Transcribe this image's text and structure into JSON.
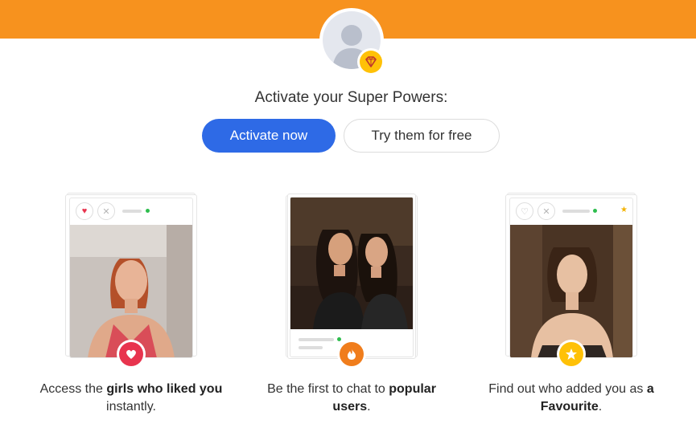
{
  "headline": "Activate your Super Powers:",
  "buttons": {
    "activate": "Activate now",
    "try_free": "Try them for free"
  },
  "features": [
    {
      "caption": [
        {
          "text": "Access the ",
          "bold": false
        },
        {
          "text": "girls who liked you",
          "bold": true
        },
        {
          "text": " instantly.",
          "bold": false
        }
      ],
      "badge_icon": "heart-icon",
      "badge_color": "#e8344e"
    },
    {
      "caption": [
        {
          "text": "Be the first to chat to ",
          "bold": false
        },
        {
          "text": "popular users",
          "bold": true
        },
        {
          "text": ".",
          "bold": false
        }
      ],
      "badge_icon": "flame-icon",
      "badge_color": "#f07d1c"
    },
    {
      "caption": [
        {
          "text": "Find out who added you as ",
          "bold": false
        },
        {
          "text": "a Favourite",
          "bold": true
        },
        {
          "text": ".",
          "bold": false
        }
      ],
      "badge_icon": "star-icon",
      "badge_color": "#ffc107"
    }
  ],
  "colors": {
    "top_bar": "#f7921e",
    "primary_button": "#2e6ae6",
    "online_dot": "#2ebd4e",
    "super_power_badge": "#ffc107"
  }
}
